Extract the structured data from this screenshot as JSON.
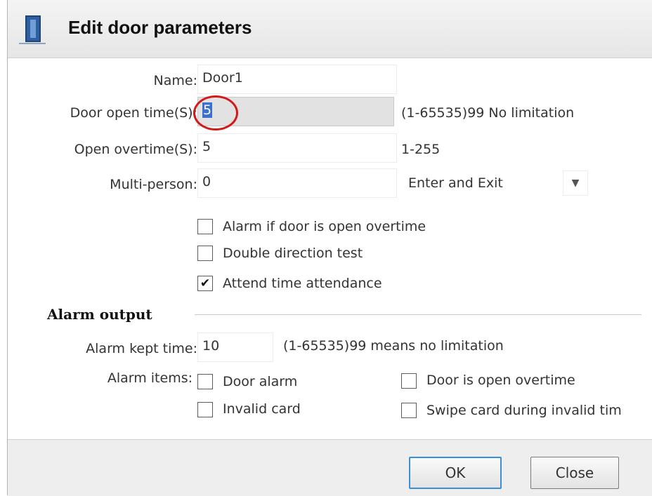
{
  "dialog": {
    "title": "Edit door parameters",
    "icon": "door-icon"
  },
  "fields": {
    "name": {
      "label": "Name:",
      "value": "Door1"
    },
    "door_open_time": {
      "label": "Door open time(S):",
      "value": "5",
      "hint": "(1-65535)99 No limitation"
    },
    "open_overtime": {
      "label": "Open overtime(S):",
      "value": "5",
      "hint": "1-255"
    },
    "multi_person": {
      "label": "Multi-person:",
      "value": "0",
      "select_value": "Enter and Exit"
    }
  },
  "options": [
    {
      "label": "Alarm if door is open overtime",
      "checked": false
    },
    {
      "label": "Double direction test",
      "checked": false
    },
    {
      "label": "Attend time attendance",
      "checked": true
    }
  ],
  "alarm_output": {
    "section_title": "Alarm output",
    "kept_time": {
      "label": "Alarm kept time:",
      "value": "10",
      "hint": "(1-65535)99 means no limitation"
    },
    "items_label": "Alarm items:",
    "items": [
      {
        "label": "Door alarm",
        "checked": false
      },
      {
        "label": "Door is open overtime",
        "checked": false
      },
      {
        "label": "Invalid card",
        "checked": false
      },
      {
        "label": "Swipe card during invalid tim",
        "checked": false
      }
    ]
  },
  "buttons": {
    "ok": "OK",
    "close": "Close"
  },
  "colors": {
    "highlight_circle": "#d11a1a",
    "selection": "#3d6fcf",
    "primary_border": "#3a8fd8"
  }
}
